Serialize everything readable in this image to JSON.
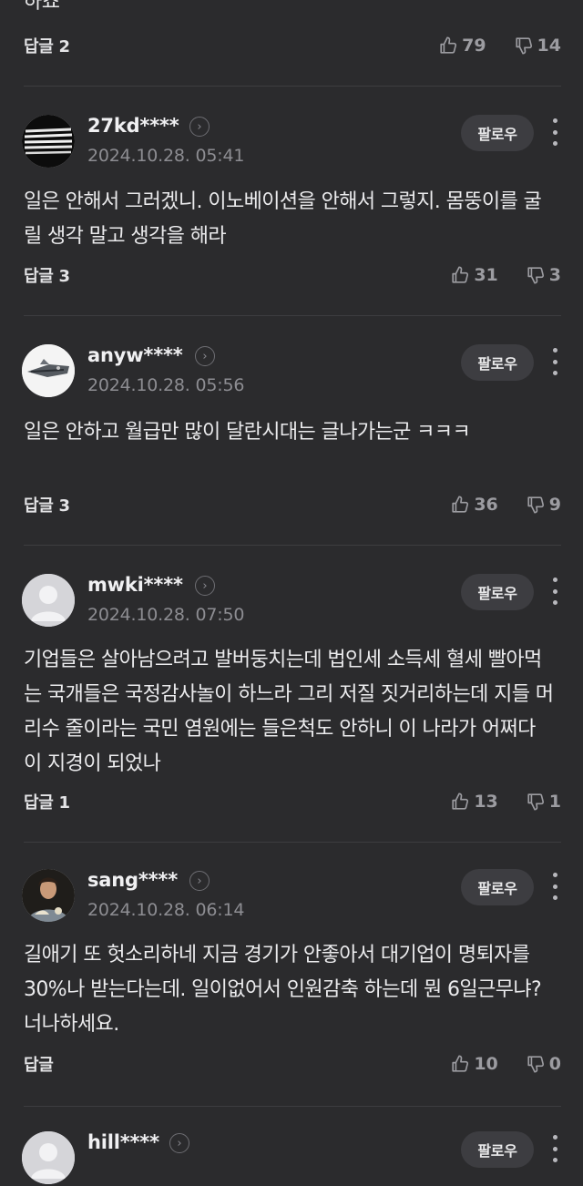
{
  "top_comment": {
    "text_fragment": "하죠",
    "reply_label": "답글 2",
    "likes": "79",
    "dislikes": "14"
  },
  "comments": [
    {
      "nick": "27kd****",
      "date": "2024.10.28. 05:41",
      "follow_label": "팔로우",
      "text": "일은 안해서 그러겠니. 이노베이션을 안해서 그렇지. 몸뚱이를 굴릴 생각 말고 생각을 해라",
      "reply_label": "답글 3",
      "likes": "31",
      "dislikes": "3"
    },
    {
      "nick": "anyw****",
      "date": "2024.10.28. 05:56",
      "follow_label": "팔로우",
      "text": "일은 안하고 월급만 많이 달란시대는 글나가는군 ㅋㅋㅋ",
      "reply_label": "답글 3",
      "likes": "36",
      "dislikes": "9"
    },
    {
      "nick": "mwki****",
      "date": "2024.10.28. 07:50",
      "follow_label": "팔로우",
      "text": "기업들은 살아남으려고 발버둥치는데 법인세 소득세 혈세 빨아먹는 국개들은 국정감사놀이 하느라 그리 저질 짓거리하는데 지들 머리수 줄이라는 국민 염원에는 들은척도 안하니 이 나라가 어쩌다 이 지경이 되었나",
      "reply_label": "답글 1",
      "likes": "13",
      "dislikes": "1"
    },
    {
      "nick": "sang****",
      "date": "2024.10.28. 06:14",
      "follow_label": "팔로우",
      "text": "길애기 또 헛소리하네 지금 경기가 안좋아서 대기업이 명퇴자를 30%나 받는다는데. 일이없어서 인원감축 하는데 뭔 6일근무냐? 너나하세요.",
      "reply_label": "답글",
      "likes": "10",
      "dislikes": "0"
    },
    {
      "nick": "hill****",
      "follow_label": "팔로우"
    }
  ],
  "icons": {
    "like": "thumbs-up-icon",
    "dislike": "thumbs-down-icon",
    "more": "more-vertical-icon",
    "profile_link": "chevron-right-circle-icon"
  }
}
